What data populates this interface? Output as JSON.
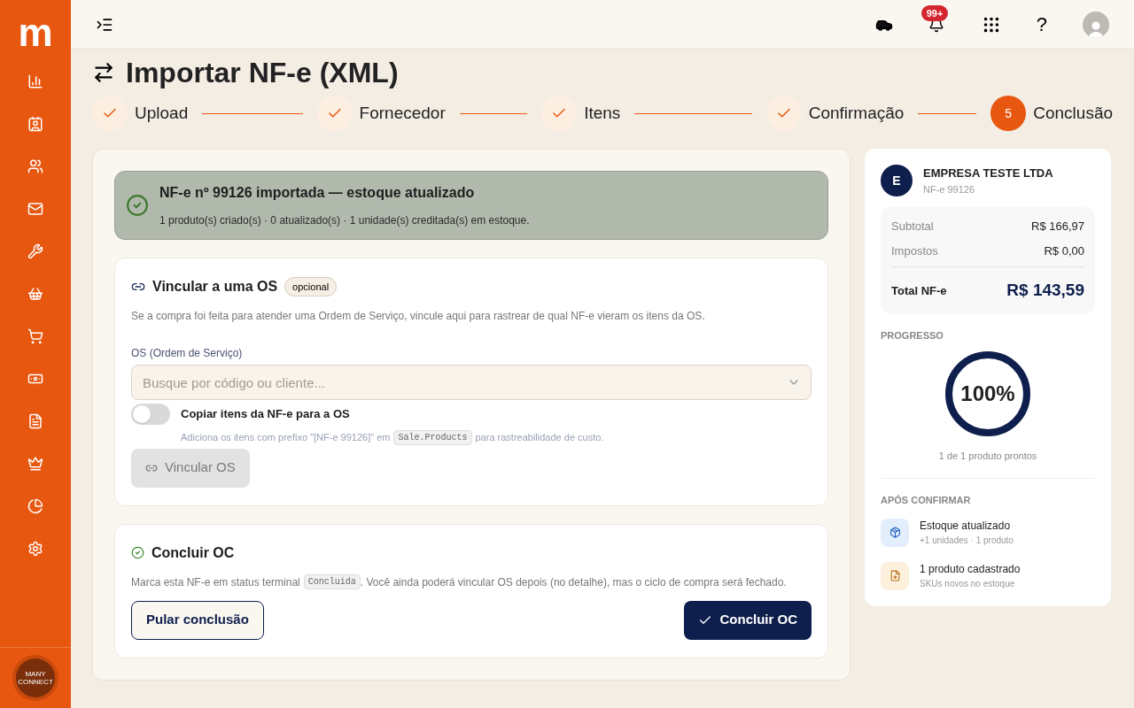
{
  "brand": {
    "logo": "m"
  },
  "sidebar": {
    "items": [
      {
        "kind": "chart"
      },
      {
        "kind": "card"
      },
      {
        "kind": "users"
      },
      {
        "kind": "mail"
      },
      {
        "kind": "wrench"
      },
      {
        "kind": "basket"
      },
      {
        "kind": "cart"
      },
      {
        "kind": "money"
      },
      {
        "kind": "file"
      },
      {
        "kind": "crown"
      },
      {
        "kind": "pie"
      },
      {
        "kind": "gear"
      }
    ],
    "footer_logo": [
      "MANY",
      "CONNECT"
    ]
  },
  "header": {
    "notification_badge": "99+",
    "help": "?"
  },
  "page_title": "Importar NF-e (XML)",
  "steps": [
    {
      "label": "Upload",
      "done": true
    },
    {
      "label": "Fornecedor",
      "done": true
    },
    {
      "label": "Itens",
      "done": true
    },
    {
      "label": "Confirmação",
      "done": true
    },
    {
      "label": "Conclusão",
      "done": false,
      "number": "5"
    }
  ],
  "success": {
    "title": "NF-e nº 99126 importada — estoque atualizado",
    "detail": "1 produto(s) criado(s) · 0 atualizado(s) · 1 unidade(s) creditada(s) em estoque."
  },
  "link_os": {
    "title": "Vincular a uma OS",
    "badge": "opcional",
    "description": "Se a compra foi feita para atender uma Ordem de Serviço, vincule aqui para rastrear de qual NF-e vieram os itens da OS.",
    "field_label": "OS (Ordem de Serviço)",
    "placeholder": "Busque por código ou cliente...",
    "toggle": {
      "label": "Copiar itens da NF-e para a OS",
      "on": false,
      "hint_before": "Adiciona os itens com prefixo \"[NF-e 99126]\" em",
      "hint_code": "Sale.Products",
      "hint_after": "para rastreabilidade de custo."
    },
    "button": {
      "label": "Vincular OS",
      "disabled": true
    }
  },
  "conclude": {
    "title": "Concluir OC",
    "text_before": "Marca esta NF-e em status terminal",
    "code": "Concluida",
    "text_after": ". Você ainda poderá vincular OS depois (no detalhe), mas o ciclo de compra será fechado.",
    "skip_button": "Pular conclusão",
    "confirm_button": "Concluir OC"
  },
  "summary": {
    "avatar": "E",
    "company": "EMPRESA TESTE LTDA",
    "document": "NF-e 99126",
    "rows": [
      {
        "label": "Subtotal",
        "value": "R$ 166,97"
      },
      {
        "label": "Impostos",
        "value": "R$ 0,00"
      }
    ],
    "total_label": "Total NF-e",
    "total_value": "R$ 143,59",
    "progress_heading": "PROGRESSO",
    "progress": {
      "level": 1,
      "reading": "100%"
    },
    "progress_caption": "1 de 1 produto prontos",
    "after_heading": "APÓS CONFIRMAR",
    "after_items": [
      {
        "kind": "stock",
        "title": "Estoque atualizado",
        "subtitle": "+1 unidades · 1 produto"
      },
      {
        "kind": "product",
        "title": "1 produto cadastrado",
        "subtitle": "SKUs novos no estoque"
      }
    ]
  }
}
